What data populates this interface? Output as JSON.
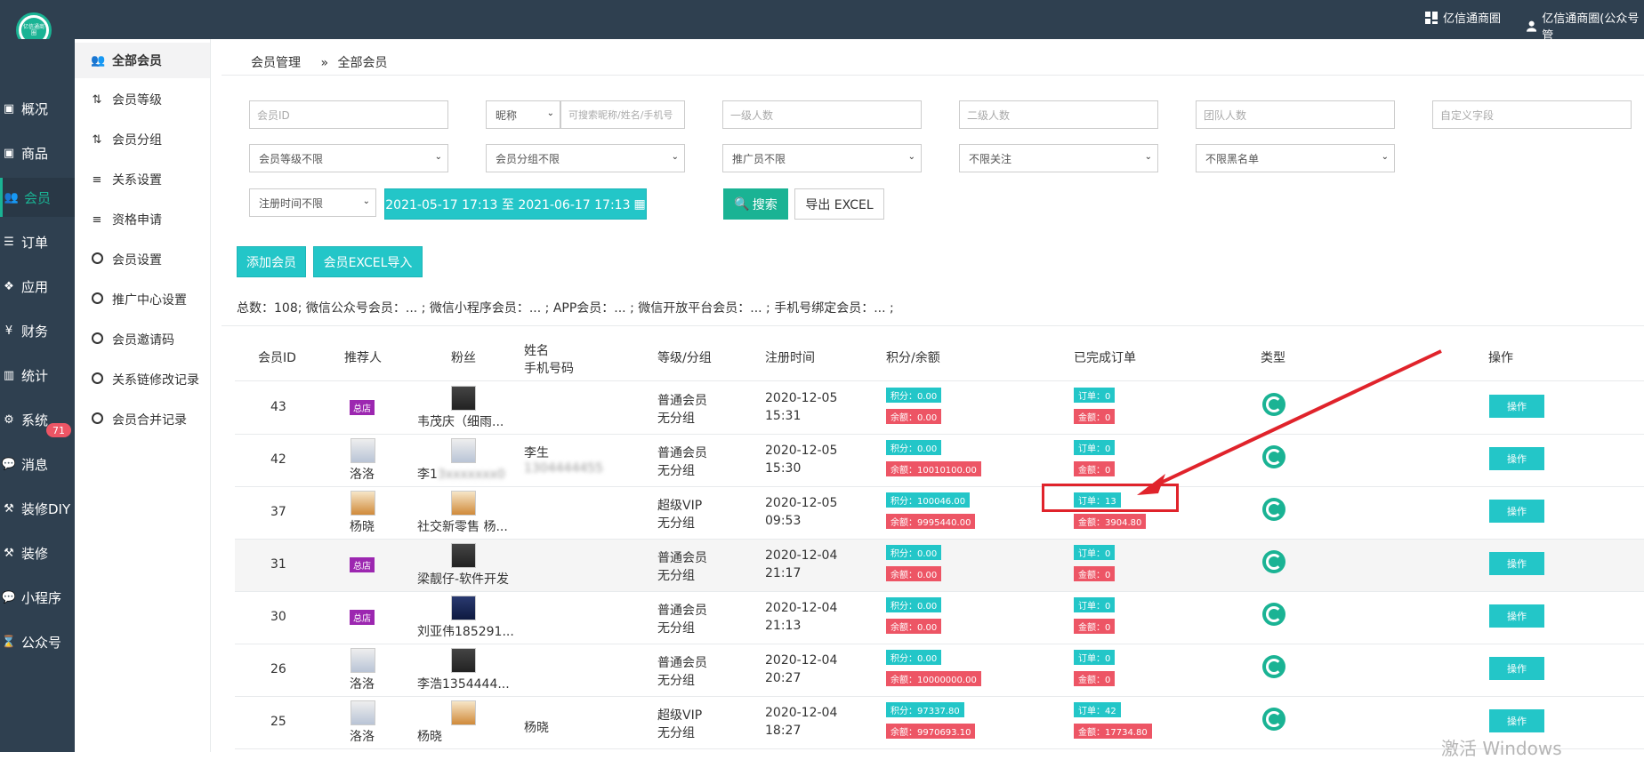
{
  "topbar": {
    "brand_logo_text": "亿信通商圈",
    "shop_label": "亿信通商圈",
    "account_label": "亿信通商圈(公众号管"
  },
  "leftnav": [
    {
      "label": "概况",
      "icon": "monitor-icon"
    },
    {
      "label": "商品",
      "icon": "box-icon"
    },
    {
      "label": "会员",
      "icon": "users-icon",
      "active": true
    },
    {
      "label": "订单",
      "icon": "list-icon"
    },
    {
      "label": "应用",
      "icon": "cubes-icon"
    },
    {
      "label": "财务",
      "icon": "yen-icon"
    },
    {
      "label": "统计",
      "icon": "chart-icon"
    },
    {
      "label": "系统",
      "icon": "gears-icon"
    },
    {
      "label": "消息",
      "icon": "chat-icon",
      "badge": "71"
    },
    {
      "label": "装修DIY",
      "icon": "gavel-icon"
    },
    {
      "label": "装修",
      "icon": "gavel-icon"
    },
    {
      "label": "小程序",
      "icon": "wechat-icon"
    },
    {
      "label": "公众号",
      "icon": "hourglass-icon"
    }
  ],
  "subnav": [
    {
      "label": "全部会员",
      "icon": "users-icon",
      "active": true
    },
    {
      "label": "会员等级",
      "icon": "sort-icon"
    },
    {
      "label": "会员分组",
      "icon": "sort-alpha-icon"
    },
    {
      "label": "关系设置",
      "icon": "sliders-icon"
    },
    {
      "label": "资格申请",
      "icon": "sliders-icon"
    },
    {
      "label": "会员设置",
      "icon": "circle-icon"
    },
    {
      "label": "推广中心设置",
      "icon": "circle-icon"
    },
    {
      "label": "会员邀请码",
      "icon": "circle-icon"
    },
    {
      "label": "关系链修改记录",
      "icon": "circle-icon"
    },
    {
      "label": "会员合并记录",
      "icon": "circle-icon"
    }
  ],
  "breadcrumb": {
    "root": "会员管理",
    "sep": "»",
    "current": "全部会员"
  },
  "filters": {
    "member_id_placeholder": "会员ID",
    "nickname_select": "昵称",
    "nickname_placeholder": "可搜索昵称/姓名/手机号",
    "level1_placeholder": "一级人数",
    "level2_placeholder": "二级人数",
    "team_placeholder": "团队人数",
    "custom_placeholder": "自定义字段",
    "level_select": "会员等级不限",
    "group_select": "会员分组不限",
    "promoter_select": "推广员不限",
    "follow_select": "不限关注",
    "blacklist_select": "不限黑名单",
    "regtime_select": "注册时间不限",
    "date_range": "2021-05-17 17:13 至 2021-06-17 17:13",
    "search_btn": "搜索",
    "export_btn": "导出 EXCEL"
  },
  "actions": {
    "add_member": "添加会员",
    "import_excel": "会员EXCEL导入"
  },
  "stats_text": "总数：108; 微信公众号会员：... ;  微信小程序会员：... ;  APP会员：... ;  微信开放平台会员：... ;  手机号绑定会员：... ;",
  "table": {
    "headers": {
      "id": "会员ID",
      "referrer": "推荐人",
      "fans": "粉丝",
      "name_line1": "姓名",
      "name_line2": "手机号码",
      "level": "等级/分组",
      "regtime": "注册时间",
      "points": "积分/余额",
      "orders": "已完成订单",
      "type": "类型",
      "op": "操作"
    },
    "store_tag": "总店",
    "points_prefix": "积分：",
    "balance_prefix": "余额：",
    "order_prefix": "订单：",
    "amount_prefix": "金额：",
    "op_label": "操作",
    "rows": [
      {
        "id": "43",
        "ref_tag": true,
        "ref_name": "",
        "fan": "韦茂庆（细雨...",
        "name": "",
        "phone": "",
        "level": "普通会员",
        "group": "无分组",
        "date": "2020-12-05",
        "time": "15:31",
        "points": "积分：0.00",
        "balance": "余额：0.00",
        "orders": "订单：0",
        "amount": "金额：0"
      },
      {
        "id": "42",
        "ref_tag": false,
        "ref_name": "洛洛",
        "fan": "李1",
        "fan_blur": "3xxxxxxx0",
        "name": "李生",
        "phone": "1304444455",
        "level": "普通会员",
        "group": "无分组",
        "date": "2020-12-05",
        "time": "15:30",
        "points": "积分：0.00",
        "balance": "余额：10010100.00",
        "orders": "订单：0",
        "amount": "金额：0"
      },
      {
        "id": "37",
        "ref_tag": false,
        "ref_name": "杨晓",
        "fan": "社交新零售 杨...",
        "name": "",
        "phone": "",
        "level": "超级VIP",
        "group": "无分组",
        "date": "2020-12-05",
        "time": "09:53",
        "points": "积分：100046.00",
        "balance": "余额：9995440.00",
        "orders": "订单：13",
        "amount": "金额：3904.80"
      },
      {
        "id": "31",
        "ref_tag": true,
        "ref_name": "",
        "fan": "梁靓仔-软件开发",
        "name": "",
        "phone": "",
        "level": "普通会员",
        "group": "无分组",
        "date": "2020-12-04",
        "time": "21:17",
        "points": "积分：0.00",
        "balance": "余额：0.00",
        "orders": "订单：0",
        "amount": "金额：0"
      },
      {
        "id": "30",
        "ref_tag": true,
        "ref_name": "",
        "fan": "刘亚伟185291...",
        "name": "",
        "phone": "",
        "level": "普通会员",
        "group": "无分组",
        "date": "2020-12-04",
        "time": "21:13",
        "points": "积分：0.00",
        "balance": "余额：0.00",
        "orders": "订单：0",
        "amount": "金额：0"
      },
      {
        "id": "26",
        "ref_tag": false,
        "ref_name": "洛洛",
        "fan": "李浩1354444...",
        "name": "",
        "phone": "",
        "level": "普通会员",
        "group": "无分组",
        "date": "2020-12-04",
        "time": "20:27",
        "points": "积分：0.00",
        "balance": "余额：10000000.00",
        "orders": "订单：0",
        "amount": "金额：0"
      },
      {
        "id": "25",
        "ref_tag": false,
        "ref_name": "洛洛",
        "fan": "杨晓",
        "name": "杨晓",
        "phone": "",
        "level": "超级VIP",
        "group": "无分组",
        "date": "2020-12-04",
        "time": "18:27",
        "points": "积分：97337.80",
        "balance": "余额：9970693.10",
        "orders": "订单：42",
        "amount": "金额：17734.80"
      }
    ]
  },
  "watermark": "激活 Windows",
  "colors": {
    "nav_bg": "#2f4050",
    "accent": "#1ab394",
    "info": "#23c6c8",
    "danger": "#ed5565",
    "annotation": "#e0232b"
  }
}
